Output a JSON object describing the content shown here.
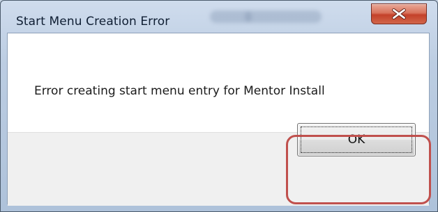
{
  "window": {
    "title": "Start Menu Creation Error"
  },
  "dialog": {
    "message": "Error creating start menu entry for Mentor Install",
    "ok_label": "OK"
  },
  "icons": {
    "close": "close-icon"
  },
  "colors": {
    "close_button": "#c4412a",
    "highlight": "#c0504d",
    "button_area": "#f0f0f0"
  }
}
